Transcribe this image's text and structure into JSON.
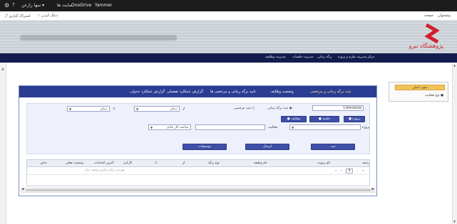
{
  "topbar": {
    "yammer": "Yammer",
    "onedrive": "OneDrive",
    "sites": "سایت ها",
    "user": "سها رازعن ▾",
    "settings_icon": "gear-icon",
    "help_icon": "help-icon"
  },
  "subbar": {
    "share": "اشتراک گذاری",
    "follow": "دنبال کردن",
    "left_links": [
      "پیشخوان",
      "صفحه"
    ]
  },
  "logo": {
    "text": "پژوهشگاه نیرو"
  },
  "nav": {
    "items": [
      "مرکز مدیریت طرح و پروژه",
      "برگه زمانی",
      "مدیریت جلسات",
      "مدیریت وظایف"
    ]
  },
  "sidebar": {
    "title": "منوی اصلی",
    "item": "نوع فعالیت"
  },
  "tabs": [
    {
      "label": "ثبت برگه زمانی و مرخصی",
      "active": true
    },
    {
      "label": "وضعیت وظایف",
      "active": false
    },
    {
      "label": "تایید برگه زمانی و مرخصی ها",
      "active": false
    },
    {
      "label": "گزارش عملکرد تفصیلی",
      "active": false
    },
    {
      "label": "گزارش عملکرد جدولی",
      "active": false
    }
  ],
  "form": {
    "date_value": "1399/08/08",
    "radio_timesheet": "ثبت برگه زمانی",
    "radio_leave": "ثبت مرخصی",
    "from_label": "از",
    "from_time_value": "زمان",
    "to_label": "تا",
    "to_time_value": "زمان",
    "type_options": [
      "پروژه",
      "جلسه",
      "وظایف"
    ],
    "project_label": "پروژه",
    "activity_label": "فعالیت",
    "work_hours_value": "ساعت کار عادی",
    "btn_submit": "ثبت",
    "btn_send": "ارسال",
    "btn_description": "توضیحات"
  },
  "grid": {
    "columns": [
      "نام پروژه",
      "نام وظیفه",
      "نوع برگه",
      "از",
      "تا",
      "کارکرد",
      "آخرین اقدامات",
      "وضعیت فعلی",
      "حذف"
    ],
    "page_value": "0",
    "empty_text": "موردی برای نمایش وجود ندارد",
    "row_prefix": "ردیف"
  }
}
